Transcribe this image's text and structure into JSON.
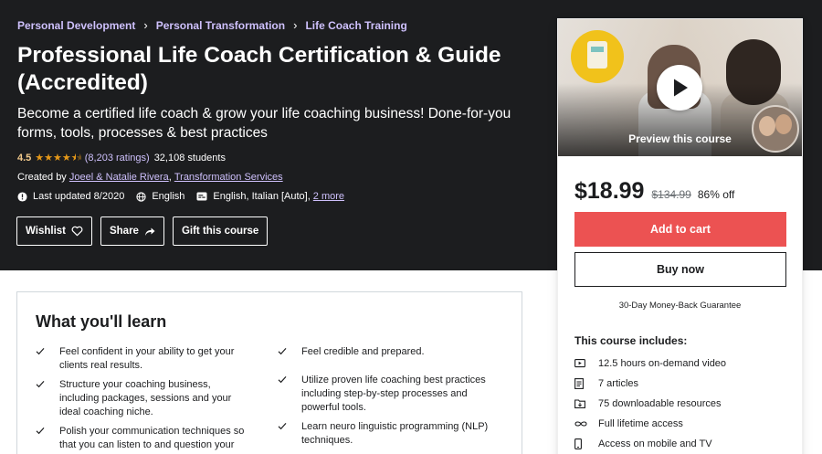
{
  "breadcrumb": [
    "Personal Development",
    "Personal Transformation",
    "Life Coach Training"
  ],
  "course": {
    "title": "Professional Life Coach Certification & Guide (Accredited)",
    "subtitle": "Become a certified life coach & grow your life coaching business! Done-for-you forms, tools, processes & best practices",
    "rating": "4.5",
    "rating_stars": 4.5,
    "ratings_count": "(8,203 ratings)",
    "students": "32,108 students",
    "created_by_label": "Created by",
    "instructors": "Joeel & Natalie Rivera",
    "instructors_sep": ",",
    "organization": "Transformation Services",
    "last_updated": "Last updated 8/2020",
    "language": "English",
    "captions": "English, Italian [Auto],",
    "captions_more": "2 more"
  },
  "actions": {
    "wishlist": "Wishlist",
    "share": "Share",
    "gift": "Gift this course"
  },
  "sidebar": {
    "preview_label": "Preview this course",
    "price": "$18.99",
    "original_price": "$134.99",
    "discount": "86% off",
    "add_to_cart": "Add to cart",
    "buy_now": "Buy now",
    "guarantee": "30-Day Money-Back Guarantee",
    "includes_title": "This course includes:",
    "includes": [
      {
        "icon": "video-icon",
        "text": "12.5 hours on-demand video"
      },
      {
        "icon": "article-icon",
        "text": "7 articles"
      },
      {
        "icon": "folder-download-icon",
        "text": "75 downloadable resources"
      },
      {
        "icon": "infinity-icon",
        "text": "Full lifetime access"
      },
      {
        "icon": "mobile-icon",
        "text": "Access on mobile and TV"
      }
    ]
  },
  "learn": {
    "title": "What you'll learn",
    "items_left": [
      "Feel confident in your ability to get your clients real results.",
      "Structure your coaching business, including packages, sessions and your ideal coaching niche.",
      "Polish your communication techniques so that you can listen to and question your"
    ],
    "items_right": [
      "Feel credible and prepared.",
      "Utilize proven life coaching best practices including step-by-step processes and powerful tools.",
      "Learn neuro linguistic programming (NLP) techniques."
    ]
  },
  "colors": {
    "hero_bg": "#1c1d1f",
    "link_purple": "#cec0fc",
    "rating_gold": "#f3ca8c",
    "star": "#e59819",
    "cart_red": "#ec5252"
  }
}
